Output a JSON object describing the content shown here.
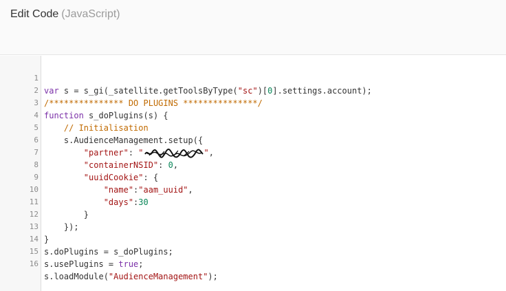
{
  "header": {
    "title": "Edit Code",
    "language": "(JavaScript)"
  },
  "editor": {
    "line_numbers": [
      "1",
      "2",
      "3",
      "4",
      "5",
      "6",
      "7",
      "8",
      "9",
      "10",
      "11",
      "12",
      "13",
      "14",
      "15",
      "16"
    ],
    "code": {
      "l1_a": "var",
      "l1_b": " s = s_gi(_satellite.getToolsByType(",
      "l1_c": "\"sc\"",
      "l1_d": ")[",
      "l1_e": "0",
      "l1_f": "].settings.account);",
      "l2": "/*************** DO PLUGINS ***************/",
      "l3_a": "function",
      "l3_b": " s_doPlugins(s) {",
      "l4": "    // Initialisation",
      "l5": "    s.AudienceManagement.setup({",
      "l6_a": "        \"partner\"",
      "l6_b": ": ",
      "l6_c": "\"",
      "l6_d": "\"",
      "l6_e": ",",
      "l7_a": "        \"containerNSID\"",
      "l7_b": ": ",
      "l7_c": "0",
      "l7_d": ",",
      "l8_a": "        \"uuidCookie\"",
      "l8_b": ": {",
      "l9_a": "            \"name\"",
      "l9_b": ":",
      "l9_c": "\"aam_uuid\"",
      "l9_d": ",",
      "l10_a": "            \"days\"",
      "l10_b": ":",
      "l10_c": "30",
      "l11": "        }",
      "l12": "    });",
      "l13": "}",
      "l14": "s.doPlugins = s_doPlugins;",
      "l15_a": "s.usePlugins = ",
      "l15_b": "true",
      "l15_c": ";",
      "l16_a": "s.loadModule(",
      "l16_b": "\"AudienceManagement\"",
      "l16_c": ");"
    }
  },
  "colors": {
    "keyword": "#7b30a8",
    "string": "#a31515",
    "number": "#098658",
    "comment": "#c06a00"
  },
  "icons": {
    "redaction": "redacted-scribble"
  }
}
